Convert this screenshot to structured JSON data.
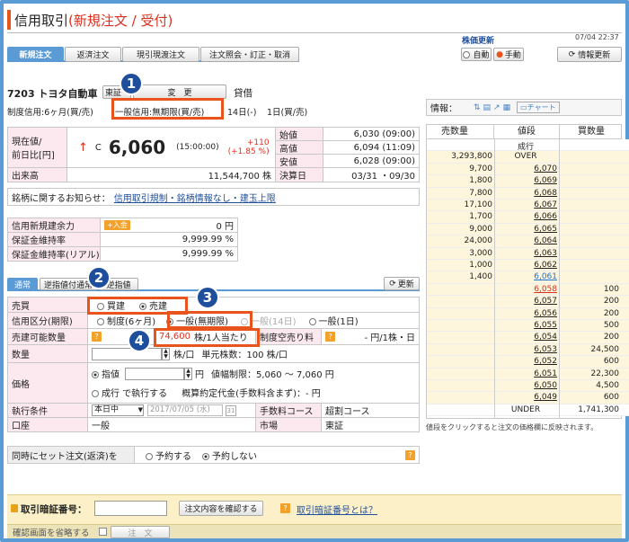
{
  "header": {
    "title_prefix": "信用取引",
    "title_red": "(新規注文 / 受付)",
    "date": "07/04 22:37",
    "price_update_label": "株価更新",
    "auto_label": "自動",
    "manual_label": "手動",
    "refresh_label": "情報更新"
  },
  "tabs": [
    "新規注文",
    "返済注文",
    "現引現渡注文",
    "注文照会・訂正・取消"
  ],
  "stock": {
    "code_name": "7203 トヨタ自動車",
    "market": "東証",
    "change_label": "変　更",
    "lending": "貸借",
    "system_credit": "制度信用:6ヶ月(買/売)",
    "general_credit": "一般信用:無期限(買/売)",
    "days": "14日(-)",
    "one_day": "1日(買/売)"
  },
  "price": {
    "label_line1": "現在値/",
    "label_line2": "前日比[円]",
    "mark": "C",
    "value": "6,060",
    "time": "(15:00:00)",
    "change": "+110",
    "change_pct": "(+1.85 %)",
    "volume_label": "出来高",
    "volume": "11,544,700 株",
    "ohlc": [
      {
        "label": "始値",
        "value": "6,030 (09:00)"
      },
      {
        "label": "高値",
        "value": "6,094 (11:09)"
      },
      {
        "label": "安値",
        "value": "6,028 (09:00)"
      },
      {
        "label": "決算日",
        "value": "03/31 ・09/30"
      }
    ]
  },
  "notice": {
    "label": "銘柄に関するお知らせ：",
    "link": "信用取引規制・銘柄情報なし・建玉上限"
  },
  "capacity": {
    "rows": [
      {
        "label": "信用新規建余力",
        "value": "0 円",
        "deposit": "入金"
      },
      {
        "label": "保証金維持率",
        "value": "9,999.99 %"
      },
      {
        "label": "保証金維持率(リアル)",
        "value": "9,999.99 %"
      }
    ]
  },
  "order_tabs": {
    "normal": "通常",
    "reverse": "逆指値付通常",
    "stop": "逆指値",
    "refresh": "更新"
  },
  "form": {
    "buysell_label": "売買",
    "buy": "買建",
    "sell": "売建",
    "credit_label": "信用区分(期限)",
    "system": "制度(6ヶ月)",
    "general_unl": "一般(無期限)",
    "general_14": "一般(14日)",
    "general_1": "一般(1日)",
    "sellable_label": "売建可能数量",
    "sellable_value": "74,600",
    "sellable_unit": "株/1人当たり",
    "short_fee_label": "制度空売り料",
    "short_fee_value": "- 円/1株・日",
    "qty_label": "数量",
    "qty_unit": "株/口",
    "unit_shares": "単元株数：100 株/口",
    "price_label": "価格",
    "limit": "指値",
    "limit_unit": "円",
    "price_range": "値幅制限：5,060 〜 7,060 円",
    "market_order": "成行 で執行する",
    "estimate": "概算約定代金(手数料含まず)：- 円",
    "exec_label": "執行条件",
    "exec_value": "本日中",
    "date_value": "2017/07/05 (水)",
    "fee_label": "手数料コース",
    "fee_value": "超割コース",
    "account_label": "口座",
    "account_value": "一般",
    "market_label": "市場",
    "market_value": "東証",
    "set_label": "同時にセット注文(返済)を",
    "reserve": "予約する",
    "no_reserve": "予約しない"
  },
  "footer": {
    "pin_label": "取引暗証番号：",
    "confirm_btn": "注文内容を確認する",
    "pin_help": "取引暗証番号とは？",
    "skip_label": "確認画面を省略する",
    "order_btn": "注　文"
  },
  "board": {
    "info_label": "情報：",
    "chart": "チャート",
    "headers": [
      "売数量",
      "値段",
      "買数量"
    ],
    "rows": [
      [
        "",
        "成行",
        ""
      ],
      [
        "3,293,800",
        "OVER",
        ""
      ],
      [
        "9,700",
        "6,070",
        ""
      ],
      [
        "1,800",
        "6,069",
        ""
      ],
      [
        "7,800",
        "6,068",
        ""
      ],
      [
        "17,100",
        "6,067",
        ""
      ],
      [
        "1,700",
        "6,066",
        ""
      ],
      [
        "9,000",
        "6,065",
        ""
      ],
      [
        "24,000",
        "6,064",
        ""
      ],
      [
        "3,000",
        "6,063",
        ""
      ],
      [
        "1,000",
        "6,062",
        ""
      ],
      [
        "1,400",
        "6,061",
        ""
      ],
      [
        "",
        "6,058",
        "100"
      ],
      [
        "",
        "6,057",
        "200"
      ],
      [
        "",
        "6,056",
        "200"
      ],
      [
        "",
        "6,055",
        "500"
      ],
      [
        "",
        "6,054",
        "200"
      ],
      [
        "",
        "6,053",
        "24,500"
      ],
      [
        "",
        "6,052",
        "600"
      ],
      [
        "",
        "6,051",
        "22,300"
      ],
      [
        "",
        "6,050",
        "4,500"
      ],
      [
        "",
        "6,049",
        "600"
      ],
      [
        "",
        "UNDER",
        "1,741,300"
      ]
    ],
    "note": "値段をクリックすると注文の価格欄に反映されます。"
  },
  "badges": [
    "1",
    "2",
    "3",
    "4"
  ]
}
